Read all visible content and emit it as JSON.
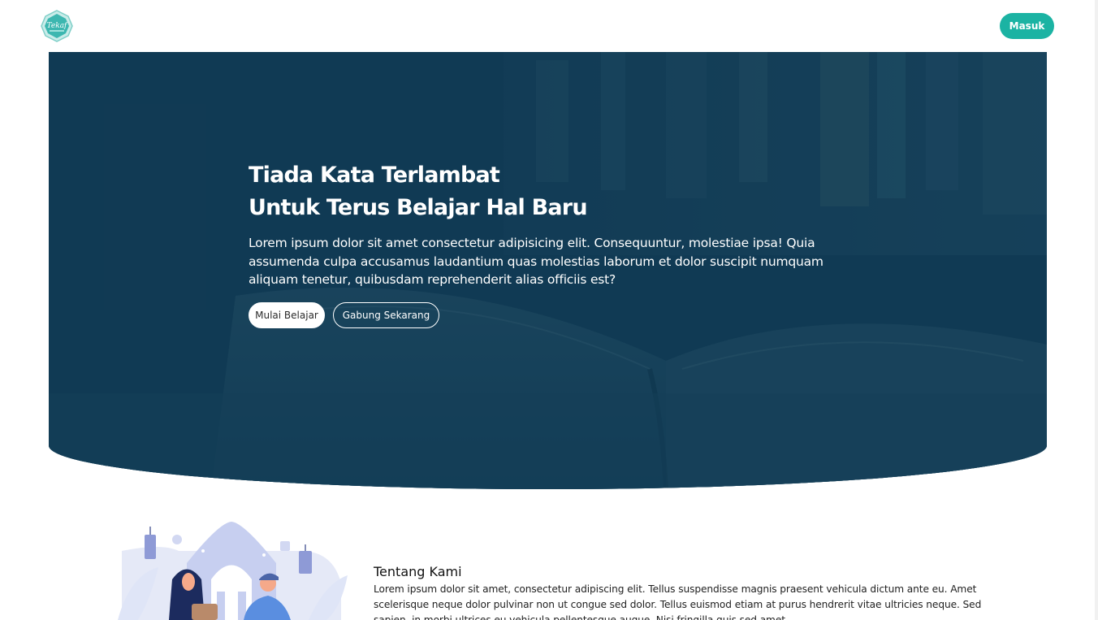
{
  "navbar": {
    "logo_text": "Tekaf",
    "login_label": "Masuk"
  },
  "hero": {
    "title_line1": "Tiada Kata Terlambat",
    "title_line2": "Untuk Terus Belajar Hal Baru",
    "description": "Lorem ipsum dolor sit amet consectetur adipisicing elit. Consequuntur, molestiae ipsa! Quia assumenda culpa accusamus laudantium quas molestias laborum et dolor suscipit numquam aliquam tenetur, quibusdam reprehenderit alias officiis est?",
    "primary_button": "Mulai Belajar",
    "secondary_button": "Gabung Sekarang"
  },
  "about": {
    "title": "Tentang Kami",
    "description": "Lorem ipsum dolor sit amet, consectetur adipiscing elit. Tellus suspendisse magnis praesent vehicula dictum ante eu. Amet scelerisque neque dolor pulvinar non ut congue sed dolor. Tellus euismod etiam at purus hendrerit vitae ultricies neque. Sed sapien, in morbi ultrices eu vehicula pellentesque augue. Nisi fringilla quis sed amet."
  },
  "colors": {
    "accent": "#1bb3a3",
    "hero_bg": "#143e58"
  }
}
